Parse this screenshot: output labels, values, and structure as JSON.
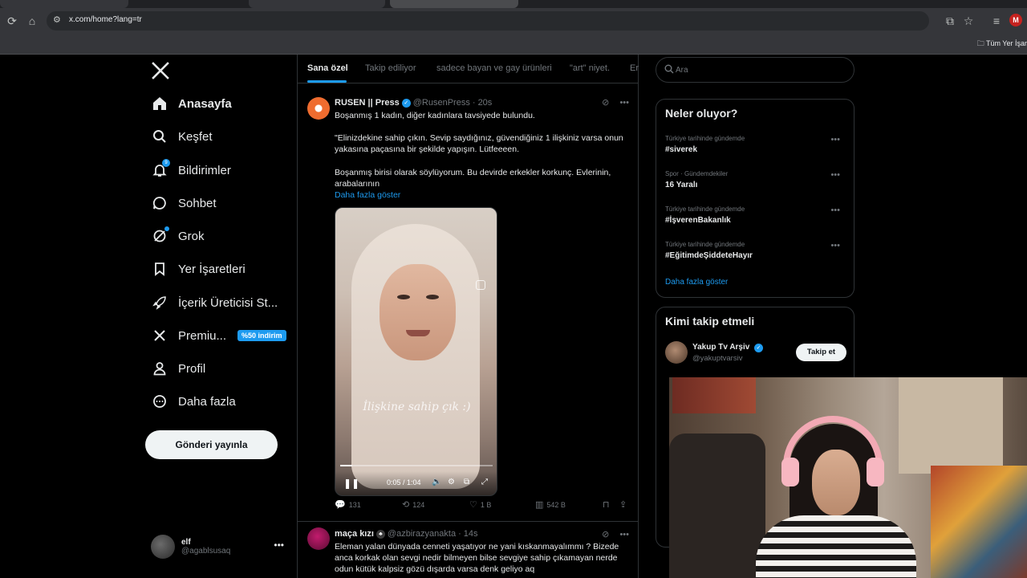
{
  "browser": {
    "url": "x.com/home?lang=tr",
    "bookmarks_folder": "Tüm Yer İşar",
    "profile_initial": "M"
  },
  "nav": {
    "items": [
      {
        "label": "Anasayfa",
        "icon": "home-icon"
      },
      {
        "label": "Keşfet",
        "icon": "search-icon"
      },
      {
        "label": "Bildirimler",
        "icon": "bell-icon",
        "badge": "9"
      },
      {
        "label": "Sohbet",
        "icon": "chat-icon"
      },
      {
        "label": "Grok",
        "icon": "grok-icon"
      },
      {
        "label": "Yer İşaretleri",
        "icon": "bookmark-icon"
      },
      {
        "label": "İçerik Üreticisi St...",
        "icon": "rocket-icon"
      },
      {
        "label": "Premiu...",
        "icon": "x-icon",
        "promo": "%50 indirim"
      },
      {
        "label": "Profil",
        "icon": "person-icon"
      },
      {
        "label": "Daha fazla",
        "icon": "more-circle-icon"
      }
    ],
    "post_button": "Gönderi yayınla",
    "account": {
      "name": "elf",
      "handle": "@agablsusaq"
    }
  },
  "timeline": {
    "tabs": [
      "Sana özel",
      "Takip ediliyor",
      "sadece bayan ve gay ürünleri",
      "\"art\" niyet.",
      "Er"
    ],
    "tweets": [
      {
        "name": "RUSEN || Press",
        "handle": "@RusenPress",
        "time": "· 20s",
        "line1": "Boşanmış 1 kadın, diğer kadınlara tavsiyede bulundu.",
        "line2": "\"Elinizdekine sahip çıkın. Sevip saydığınız, güvendiğiniz 1 ilişkiniz varsa onun yakasına paçasına bir şekilde yapışın. Lütfeeeen.",
        "line3": "Boşanmış birisi olarak söylüyorum. Bu devirde erkekler korkunç. Evlerinin, arabalarının",
        "show_more": "Daha fazla göster",
        "video": {
          "caption": "İlişkine sahip çık :)",
          "time": "0:05 / 1:04",
          "progress": 0.08
        },
        "actions": {
          "replies": "131",
          "reposts": "124",
          "likes": "1 B",
          "views": "542 B"
        }
      },
      {
        "name": "maça kızı",
        "handle": "@azbirazyanakta",
        "time": "· 14s",
        "text": "Eleman yalan dünyada cenneti yaşatıyor ne yani kıskanmayalımmı ? Bizede anca korkak olan sevgi nedir bilmeyen bilse sevgiye sahip çıkamayan nerde odun kütük kalpsiz gözü dışarda varsa denk geliyo aq"
      }
    ]
  },
  "sidebar": {
    "search_placeholder": "Ara",
    "trends_title": "Neler oluyor?",
    "trends": [
      {
        "context": "Türkiye tarihinde gündemde",
        "name": "#siverek"
      },
      {
        "context": "Spor · Gündemdekiler",
        "name": "16 Yaralı"
      },
      {
        "context": "Türkiye tarihinde gündemde",
        "name": "#İşverenBakanlık"
      },
      {
        "context": "Türkiye tarihinde gündemde",
        "name": "#EğitimdeŞiddeteHayır"
      }
    ],
    "trends_more": "Daha fazla göster",
    "who_title": "Kimi takip etmeli",
    "who": {
      "name": "Yakup Tv Arşiv",
      "handle": "@yakuptvarsiv",
      "follow": "Takip et"
    }
  },
  "colors": {
    "accent": "#1d9bf0",
    "background": "#000000",
    "muted": "#71767b",
    "border": "#2f3336"
  }
}
